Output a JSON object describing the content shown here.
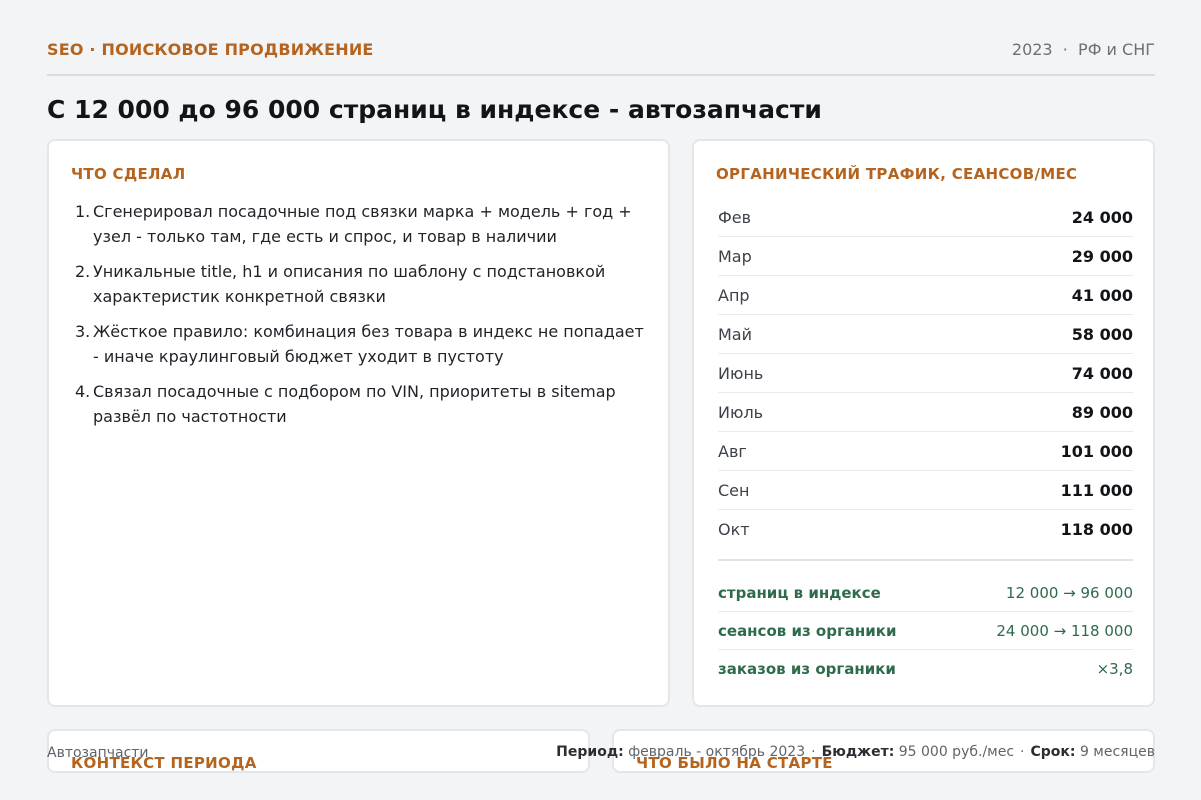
{
  "header": {
    "tag": "SEO · ПОИСКОВОЕ ПРОДВИЖЕНИЕ",
    "meta": "2023  ·  РФ и СНГ"
  },
  "title": "С 12 000 до 96 000 страниц в индексе - автозапчасти",
  "work": {
    "title": "ЧТО СДЕЛАЛ",
    "steps": [
      "Сгенерировал посадочные под связки марка + модель + год + узел - только там, где есть и спрос, и товар в наличии",
      "Уникальные title, h1 и описания по шаблону с подстановкой характеристик конкретной связки",
      "Жёсткое правило: комбинация без товара в индекс не попадает - иначе краулинговый бюджет уходит в пустоту",
      "Связал посадочные с подбором по VIN, приоритеты в sitemap развёл по частотности"
    ]
  },
  "traffic": {
    "title": "ОРГАНИЧЕСКИЙ ТРАФИК, СЕАНСОВ/МЕС",
    "months": [
      {
        "month": "Фев",
        "value": "24 000"
      },
      {
        "month": "Мар",
        "value": "29 000"
      },
      {
        "month": "Апр",
        "value": "41 000"
      },
      {
        "month": "Май",
        "value": "58 000"
      },
      {
        "month": "Июнь",
        "value": "74 000"
      },
      {
        "month": "Июль",
        "value": "89 000"
      },
      {
        "month": "Авг",
        "value": "101 000"
      },
      {
        "month": "Сен",
        "value": "111 000"
      },
      {
        "month": "Окт",
        "value": "118 000"
      }
    ],
    "summary": [
      {
        "label": "страниц в индексе",
        "value": "12 000 → 96 000"
      },
      {
        "label": "сеансов из органики",
        "value": "24 000 → 118 000"
      },
      {
        "label": "заказов из органики",
        "value": "×3,8"
      }
    ]
  },
  "context": {
    "title": "КОНТЕКСТ ПЕРИОДА"
  },
  "start": {
    "title": "ЧТО БЫЛО НА СТАРТЕ"
  },
  "footer": {
    "niche": "Автозапчасти",
    "period_label": "Период:",
    "period_value": "февраль - октябрь 2023",
    "budget_label": "Бюджет:",
    "budget_value": "95 000 руб./мес",
    "term_label": "Срок:",
    "term_value": "9 месяцев"
  }
}
